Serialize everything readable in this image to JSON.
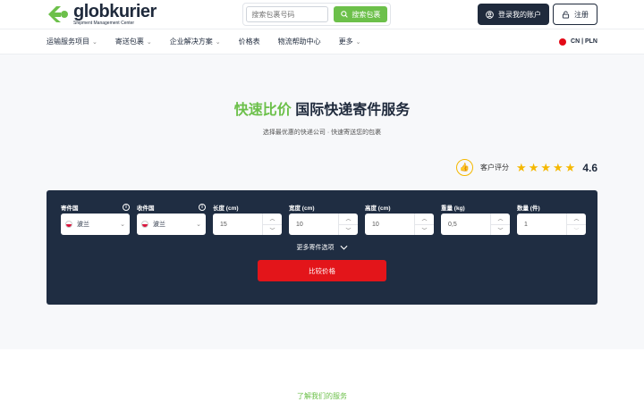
{
  "header": {
    "logo_name": "globkurier",
    "logo_tagline": "Shipment Management Center",
    "search_placeholder": "搜索包裹号码",
    "search_button": "搜索包裹",
    "login_button": "登录我的账户",
    "register_button": "注册"
  },
  "nav": {
    "items": [
      {
        "label": "运输服务项目",
        "dropdown": true
      },
      {
        "label": "寄送包裹",
        "dropdown": true
      },
      {
        "label": "企业解决方案",
        "dropdown": true
      },
      {
        "label": "价格表",
        "dropdown": false
      },
      {
        "label": "物流帮助中心",
        "dropdown": false
      },
      {
        "label": "更多",
        "dropdown": true
      }
    ],
    "language": "CN | PLN"
  },
  "hero": {
    "title_accent": "快速比价",
    "title_rest": "国际快递寄件服务",
    "subtitle": "选择最优惠的快递公司 · 快速寄送您的包裹"
  },
  "rating": {
    "label": "客户评分",
    "stars": 5,
    "score": "4.6"
  },
  "form": {
    "from_label": "寄件国",
    "to_label": "收件国",
    "from_country": "波兰",
    "to_country": "波兰",
    "length_label": "长度 (cm)",
    "width_label": "宽度 (cm)",
    "height_label": "高度 (cm)",
    "weight_label": "重量 (kg)",
    "quantity_label": "数量 (件)",
    "length_value": "15",
    "width_value": "10",
    "height_value": "10",
    "weight_value": "0,5",
    "quantity_value": "1",
    "more_options": "更多寄件选项",
    "submit": "比较价格"
  },
  "footer": {
    "link": "了解我们的服务"
  }
}
